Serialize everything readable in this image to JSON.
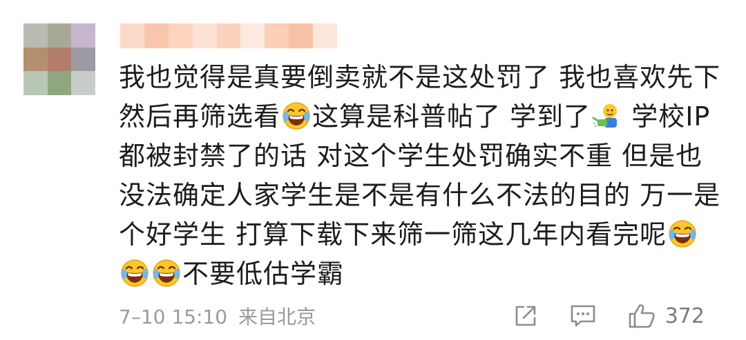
{
  "comment": {
    "segments": [
      {
        "type": "text",
        "value": "我也觉得是真要倒卖就不是这处罚了 我也喜欢先下然后再筛选看"
      },
      {
        "type": "emoji",
        "icon": "laugh-cry-emoji"
      },
      {
        "type": "text",
        "value": "这算是科普帖了 学到了"
      },
      {
        "type": "emoji",
        "icon": "watering-can-emoji"
      },
      {
        "type": "text",
        "value": " 学校IP都被封禁了的话 对这个学生处罚确实不重 但是也没法确定人家学生是不是有什么不法的目的 万一是个好学生 打算下载下来筛一筛这几年内看完呢"
      },
      {
        "type": "emoji",
        "icon": "laugh-cry-emoji"
      },
      {
        "type": "emoji",
        "icon": "laugh-cry-emoji"
      },
      {
        "type": "emoji",
        "icon": "laugh-cry-emoji"
      },
      {
        "type": "text",
        "value": "不要低估学霸"
      }
    ]
  },
  "meta": {
    "time": "7–10 15:10",
    "location": "来自北京"
  },
  "actions": {
    "like_count": "372",
    "share_icon": "share-icon",
    "comment_icon": "comment-icon",
    "like_icon": "thumbs-up-icon"
  },
  "colors": {
    "text": "#1c1c1c",
    "meta": "#9a9a9a",
    "icon": "#8c8c8c"
  }
}
